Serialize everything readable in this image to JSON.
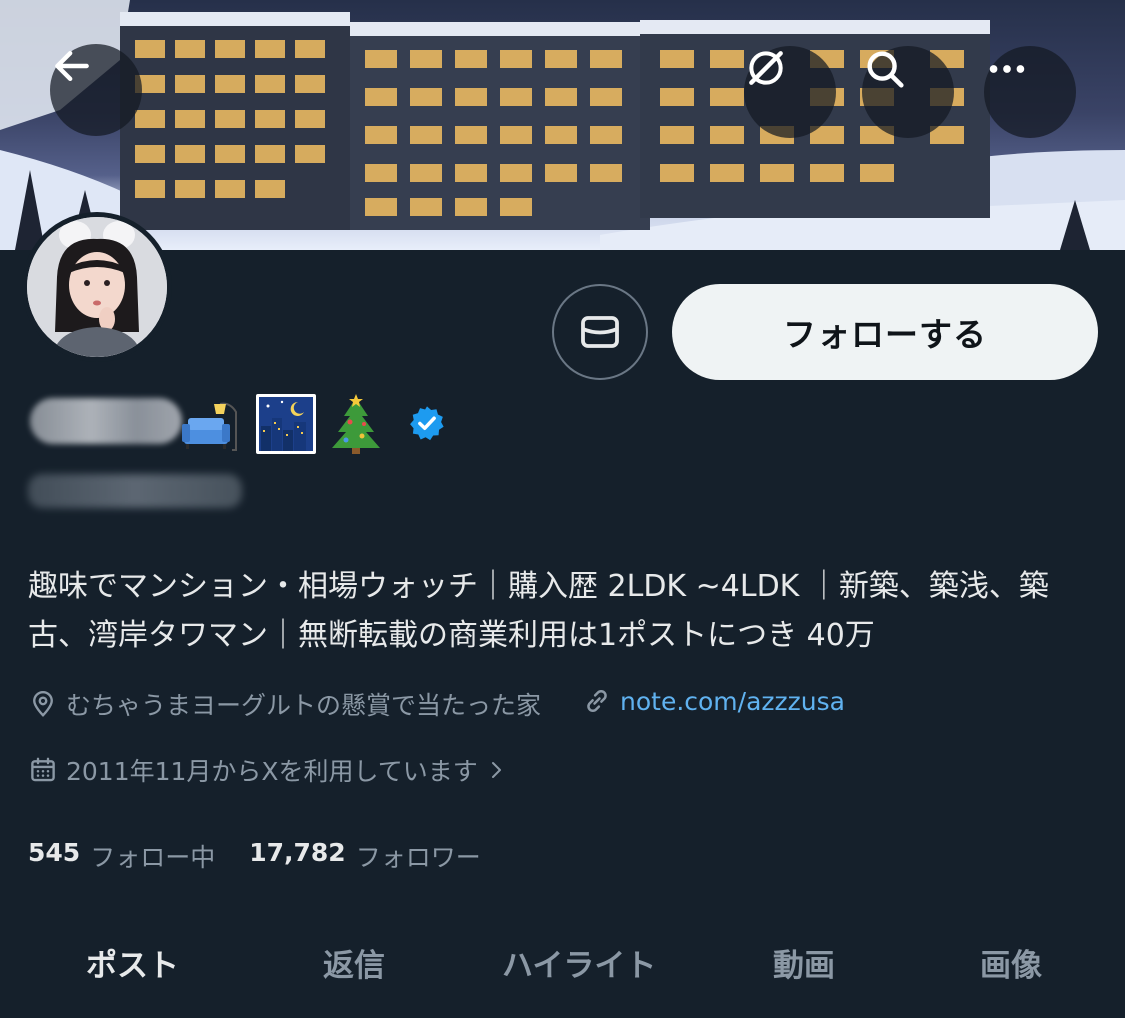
{
  "header": {
    "back_icon": "arrow-left-icon",
    "grok_icon": "grok-icon",
    "search_icon": "search-icon",
    "more_icon": "more-horizontal-icon"
  },
  "profile": {
    "name_emojis": [
      "couch-and-lamp",
      "night-with-stars",
      "christmas-tree"
    ],
    "verified": true,
    "follow_label": "フォローする",
    "message_icon": "envelope-icon",
    "bio": "趣味でマンション・相場ウォッチ｜購入歴 2LDK ~4LDK ｜新築、築浅、築古、湾岸タワマン｜無断転載の商業利用は1ポストにつき 40万",
    "location": "むちゃうまヨーグルトの懸賞で当たった家",
    "website": "note.com/azzzusa",
    "joined": "2011年11月からXを利用しています",
    "following_count": "545",
    "following_label": "フォロー中",
    "followers_count": "17,782",
    "followers_label": "フォロワー"
  },
  "tabs": [
    {
      "label": "ポスト",
      "active": true
    },
    {
      "label": "返信",
      "active": false
    },
    {
      "label": "ハイライト",
      "active": false
    },
    {
      "label": "動画",
      "active": false
    },
    {
      "label": "画像",
      "active": false
    }
  ],
  "colors": {
    "background": "#15202b",
    "accent_link": "#60b2f0",
    "verified": "#1d9bf0",
    "muted_text": "#8b98a5"
  }
}
